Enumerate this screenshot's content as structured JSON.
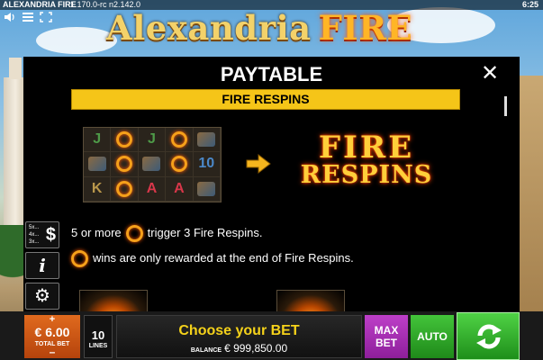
{
  "status_bar": {
    "app_title": "ALEXANDRIA FIRE",
    "build": "1.170.0-rc n2.142.0",
    "clock": "6:25"
  },
  "system_icons": [
    "speaker-icon",
    "menu-icon",
    "fullscreen-icon"
  ],
  "logo": {
    "word1": "Alexandria",
    "word2": "FIRE"
  },
  "paytable": {
    "title": "PAYTABLE",
    "close_label": "✕",
    "section_title": "FIRE RESPINS",
    "reel_grid": [
      [
        "J",
        "fire",
        "J",
        "fire",
        "art"
      ],
      [
        "art",
        "fire",
        "art",
        "fire",
        "10"
      ],
      [
        "K",
        "fire",
        "A",
        "A",
        "art"
      ]
    ],
    "feature_logo": {
      "line1": "FIRE",
      "line2": "RESPINS"
    },
    "rule1": {
      "before": "5 or more",
      "after": "trigger 3 Fire Respins."
    },
    "rule2": {
      "after": "wins are only rewarded at the end of Fire Respins."
    }
  },
  "side_buttons": {
    "paytable_multipliers": [
      "5x...",
      "4x...",
      "3x..."
    ],
    "paytable_symbol": "$",
    "info_symbol": "i",
    "settings_symbol": "⚙"
  },
  "controls": {
    "total_bet_plus": "+",
    "total_bet_value": "€ 6.00",
    "total_bet_label": "TOTAL BET",
    "total_bet_minus": "–",
    "lines_value": "10",
    "lines_label": "LINES",
    "message": "Choose your BET",
    "balance_label": "BALANCE",
    "balance_value": "€ 999,850.00",
    "max_bet_line1": "MAX",
    "max_bet_line2": "BET",
    "auto_label": "AUTO"
  },
  "colors": {
    "banner": "#f5c518",
    "total_bet": "#e06a1e",
    "max_bet": "#bd3fc8",
    "auto": "#43c43a",
    "spin": "#4fd245",
    "message_text": "#f5d21a"
  }
}
